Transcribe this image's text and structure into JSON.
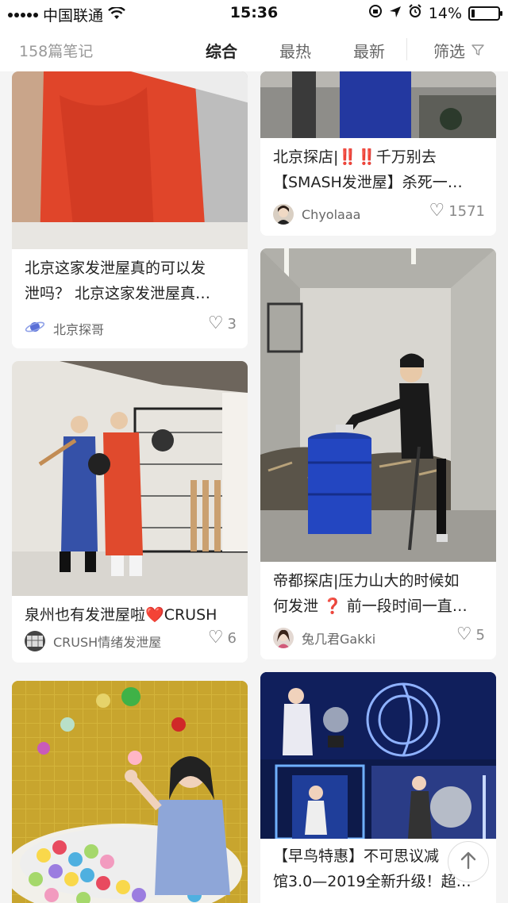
{
  "status_bar": {
    "carrier": "中国联通",
    "time": "15:36",
    "battery": "14%",
    "battery_level": 0.14,
    "icons": [
      "signal-icon",
      "wifi-icon",
      "rotation-lock-icon",
      "location-icon",
      "alarm-icon",
      "battery-icon"
    ]
  },
  "filter_bar": {
    "note_count": "158篇笔记",
    "tabs": [
      {
        "label": "综合",
        "active": true
      },
      {
        "label": "最热",
        "active": false
      },
      {
        "label": "最新",
        "active": false
      }
    ],
    "filter_label": "筛选",
    "filter_icon": "funnel-icon"
  },
  "cards": [
    {
      "title_line1": "北京这家发泄屋真的可以发",
      "title_line2": "泄吗？ 北京这家发泄屋真…",
      "author": "北京探哥",
      "likes": "3",
      "image": "workers-in-orange-overalls"
    },
    {
      "title_line1": "北京探店|",
      "title_emoji": "‼️‼️",
      "title_line1_end": "千万别去",
      "title_line2": "【SMASH发泄屋】杀死一…",
      "author": "Chyolaaa",
      "likes": "1571",
      "image": "room-with-barrel"
    },
    {
      "title_line1": "泉州也有发泄屋啦",
      "title_emoji": "❤️",
      "title_line1_end": "CRUSH",
      "author": "CRUSH情绪发泄屋",
      "likes": "6",
      "image": "two-women-in-jumpsuits"
    },
    {
      "title_line1": "帝都探店|压力山大的时候如",
      "title_line2_start": "何发泄",
      "title_emoji": "❓",
      "title_line2_end": "前一段时间一直…",
      "author": "兔几君Gakki",
      "likes": "5",
      "image": "woman-on-blue-barrel"
    },
    {
      "image": "ball-pit-gold-room"
    },
    {
      "title_line1": "【早鸟特惠】不可思议减",
      "title_line2": "馆3.0—2019全新升级！超…",
      "image": "blue-neon-rooms"
    }
  ],
  "colors": {
    "accent_red": "#e02020",
    "background": "#f4f4f4"
  }
}
